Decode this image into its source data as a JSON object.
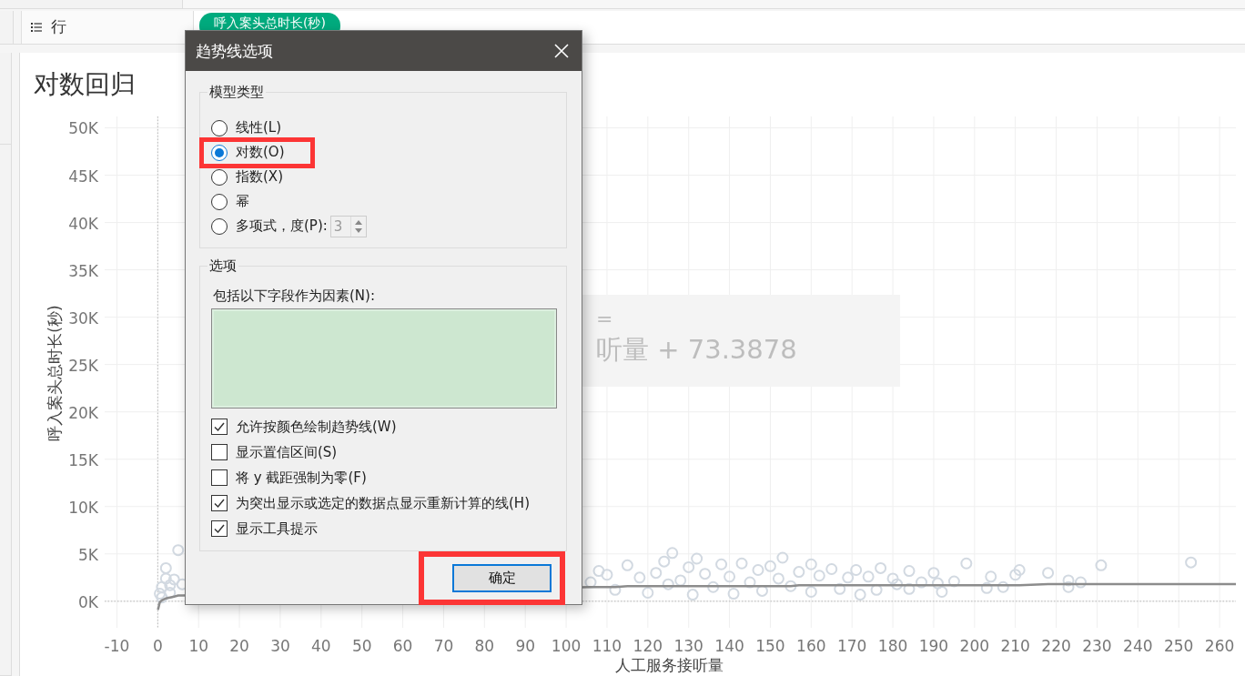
{
  "rows_shelf": {
    "label": "行",
    "pills": [
      {
        "text": "呼入案头总时长(秒)"
      }
    ]
  },
  "worksheet": {
    "title": "对数回归",
    "chart_data": {
      "type": "scatter",
      "grid": true,
      "xlabel": "人工服务接听量",
      "ylabel": "呼入案头总时长(秒)",
      "xlim": [
        -13,
        264
      ],
      "ylim": [
        -2800,
        51200
      ],
      "xticks": [
        -10,
        0,
        10,
        20,
        30,
        40,
        50,
        60,
        70,
        80,
        90,
        100,
        110,
        120,
        130,
        140,
        150,
        160,
        170,
        180,
        190,
        200,
        210,
        220,
        230,
        240,
        250,
        260
      ],
      "yticks": [
        {
          "value": 0,
          "label": "0K"
        },
        {
          "value": 5000,
          "label": "5K"
        },
        {
          "value": 10000,
          "label": "10K"
        },
        {
          "value": 15000,
          "label": "15K"
        },
        {
          "value": 20000,
          "label": "20K"
        },
        {
          "value": 25000,
          "label": "25K"
        },
        {
          "value": 30000,
          "label": "30K"
        },
        {
          "value": 35000,
          "label": "35K"
        },
        {
          "value": 40000,
          "label": "40K"
        },
        {
          "value": 45000,
          "label": "45K"
        },
        {
          "value": 50000,
          "label": "50K"
        }
      ],
      "x": [
        0.05,
        0.5,
        1,
        1,
        2,
        2,
        3,
        3,
        4,
        5,
        6,
        106,
        108,
        110,
        112,
        115,
        118,
        120,
        122,
        124,
        125,
        126,
        128,
        130,
        131,
        132,
        134,
        136,
        138,
        140,
        141,
        143,
        145,
        147,
        148,
        150,
        152,
        153,
        155,
        157,
        160,
        160,
        162,
        165,
        167,
        169,
        171,
        172,
        174,
        176,
        177,
        180,
        181,
        184,
        184,
        187,
        190,
        191,
        192,
        195,
        198,
        203,
        204,
        207,
        210,
        211,
        218,
        223,
        223,
        226,
        231,
        253,
        264
      ],
      "series": [
        {
          "color": "#d2d9e1",
          "values": [
            null,
            800,
            400,
            1500,
            2400,
            3500,
            1700,
            900,
            2300,
            5400,
            1800,
            2000,
            3200,
            2800,
            1200,
            3800,
            2500,
            900,
            3000,
            4200,
            1800,
            5100,
            2200,
            3600,
            700,
            4500,
            2900,
            1500,
            3900,
            2600,
            800,
            4000,
            2000,
            3300,
            1100,
            3700,
            2400,
            4600,
            1600,
            3100,
            3900,
            1000,
            2700,
            3400,
            1300,
            2500,
            3300,
            700,
            2600,
            1200,
            3500,
            2400,
            1800,
            3200,
            1300,
            2000,
            3000,
            1900,
            1000,
            2100,
            4000,
            1400,
            2600,
            1500,
            2800,
            3300,
            3000,
            1500,
            2200,
            2000,
            3800,
            4100,
            null
          ]
        },
        {
          "type": "line",
          "color": "#8c8c8c",
          "values": [
            -900,
            -100,
            100,
            100,
            300,
            300,
            400,
            400,
            500,
            600,
            600,
            1500,
            1500,
            1500,
            1500,
            1600,
            1600,
            1600,
            1600,
            1600,
            1600,
            1600,
            1600,
            1600,
            1600,
            1600,
            1600,
            1600,
            1600,
            1600,
            1600,
            1600,
            1600,
            1600,
            1600,
            1600,
            1600,
            1600,
            1600,
            1700,
            1700,
            1700,
            1700,
            1700,
            1700,
            1700,
            1700,
            1700,
            1700,
            1700,
            1700,
            1700,
            1700,
            1700,
            1700,
            1700,
            1700,
            1700,
            1700,
            1700,
            1700,
            1700,
            1700,
            1700,
            1700,
            1700,
            1800,
            1800,
            1800,
            1800,
            1800,
            1800,
            1800
          ]
        }
      ]
    },
    "trend_equation": {
      "lines": [
        "=",
        "听量 + 73.3878"
      ]
    }
  },
  "dialog": {
    "title": "趋势线选项",
    "model_group": {
      "title": "模型类型",
      "options": [
        {
          "label": "线性(L)",
          "selected": false,
          "highlighted": false
        },
        {
          "label": "对数(O)",
          "selected": true,
          "highlighted": true
        },
        {
          "label": "指数(X)",
          "selected": false,
          "highlighted": false
        },
        {
          "label": "幂",
          "selected": false,
          "highlighted": false
        },
        {
          "label": "多项式，度(P):",
          "selected": false,
          "highlighted": false,
          "kind": "degree"
        }
      ],
      "degree": {
        "value": "3",
        "disabled": true
      }
    },
    "options_group": {
      "title": "选项",
      "factors_label": "包括以下字段作为因素(N):",
      "checkboxes": [
        {
          "label": "允许按颜色绘制趋势线(W)",
          "checked": true
        },
        {
          "label": "显示置信区间(S)",
          "checked": false
        },
        {
          "label": "将 y 截距强制为零(F)",
          "checked": false
        },
        {
          "label": "为突出显示或选定的数据点显示重新计算的线(H)",
          "checked": true
        },
        {
          "label": "显示工具提示",
          "checked": true
        }
      ]
    },
    "ok_button": {
      "label": "确定",
      "highlighted": true
    }
  }
}
